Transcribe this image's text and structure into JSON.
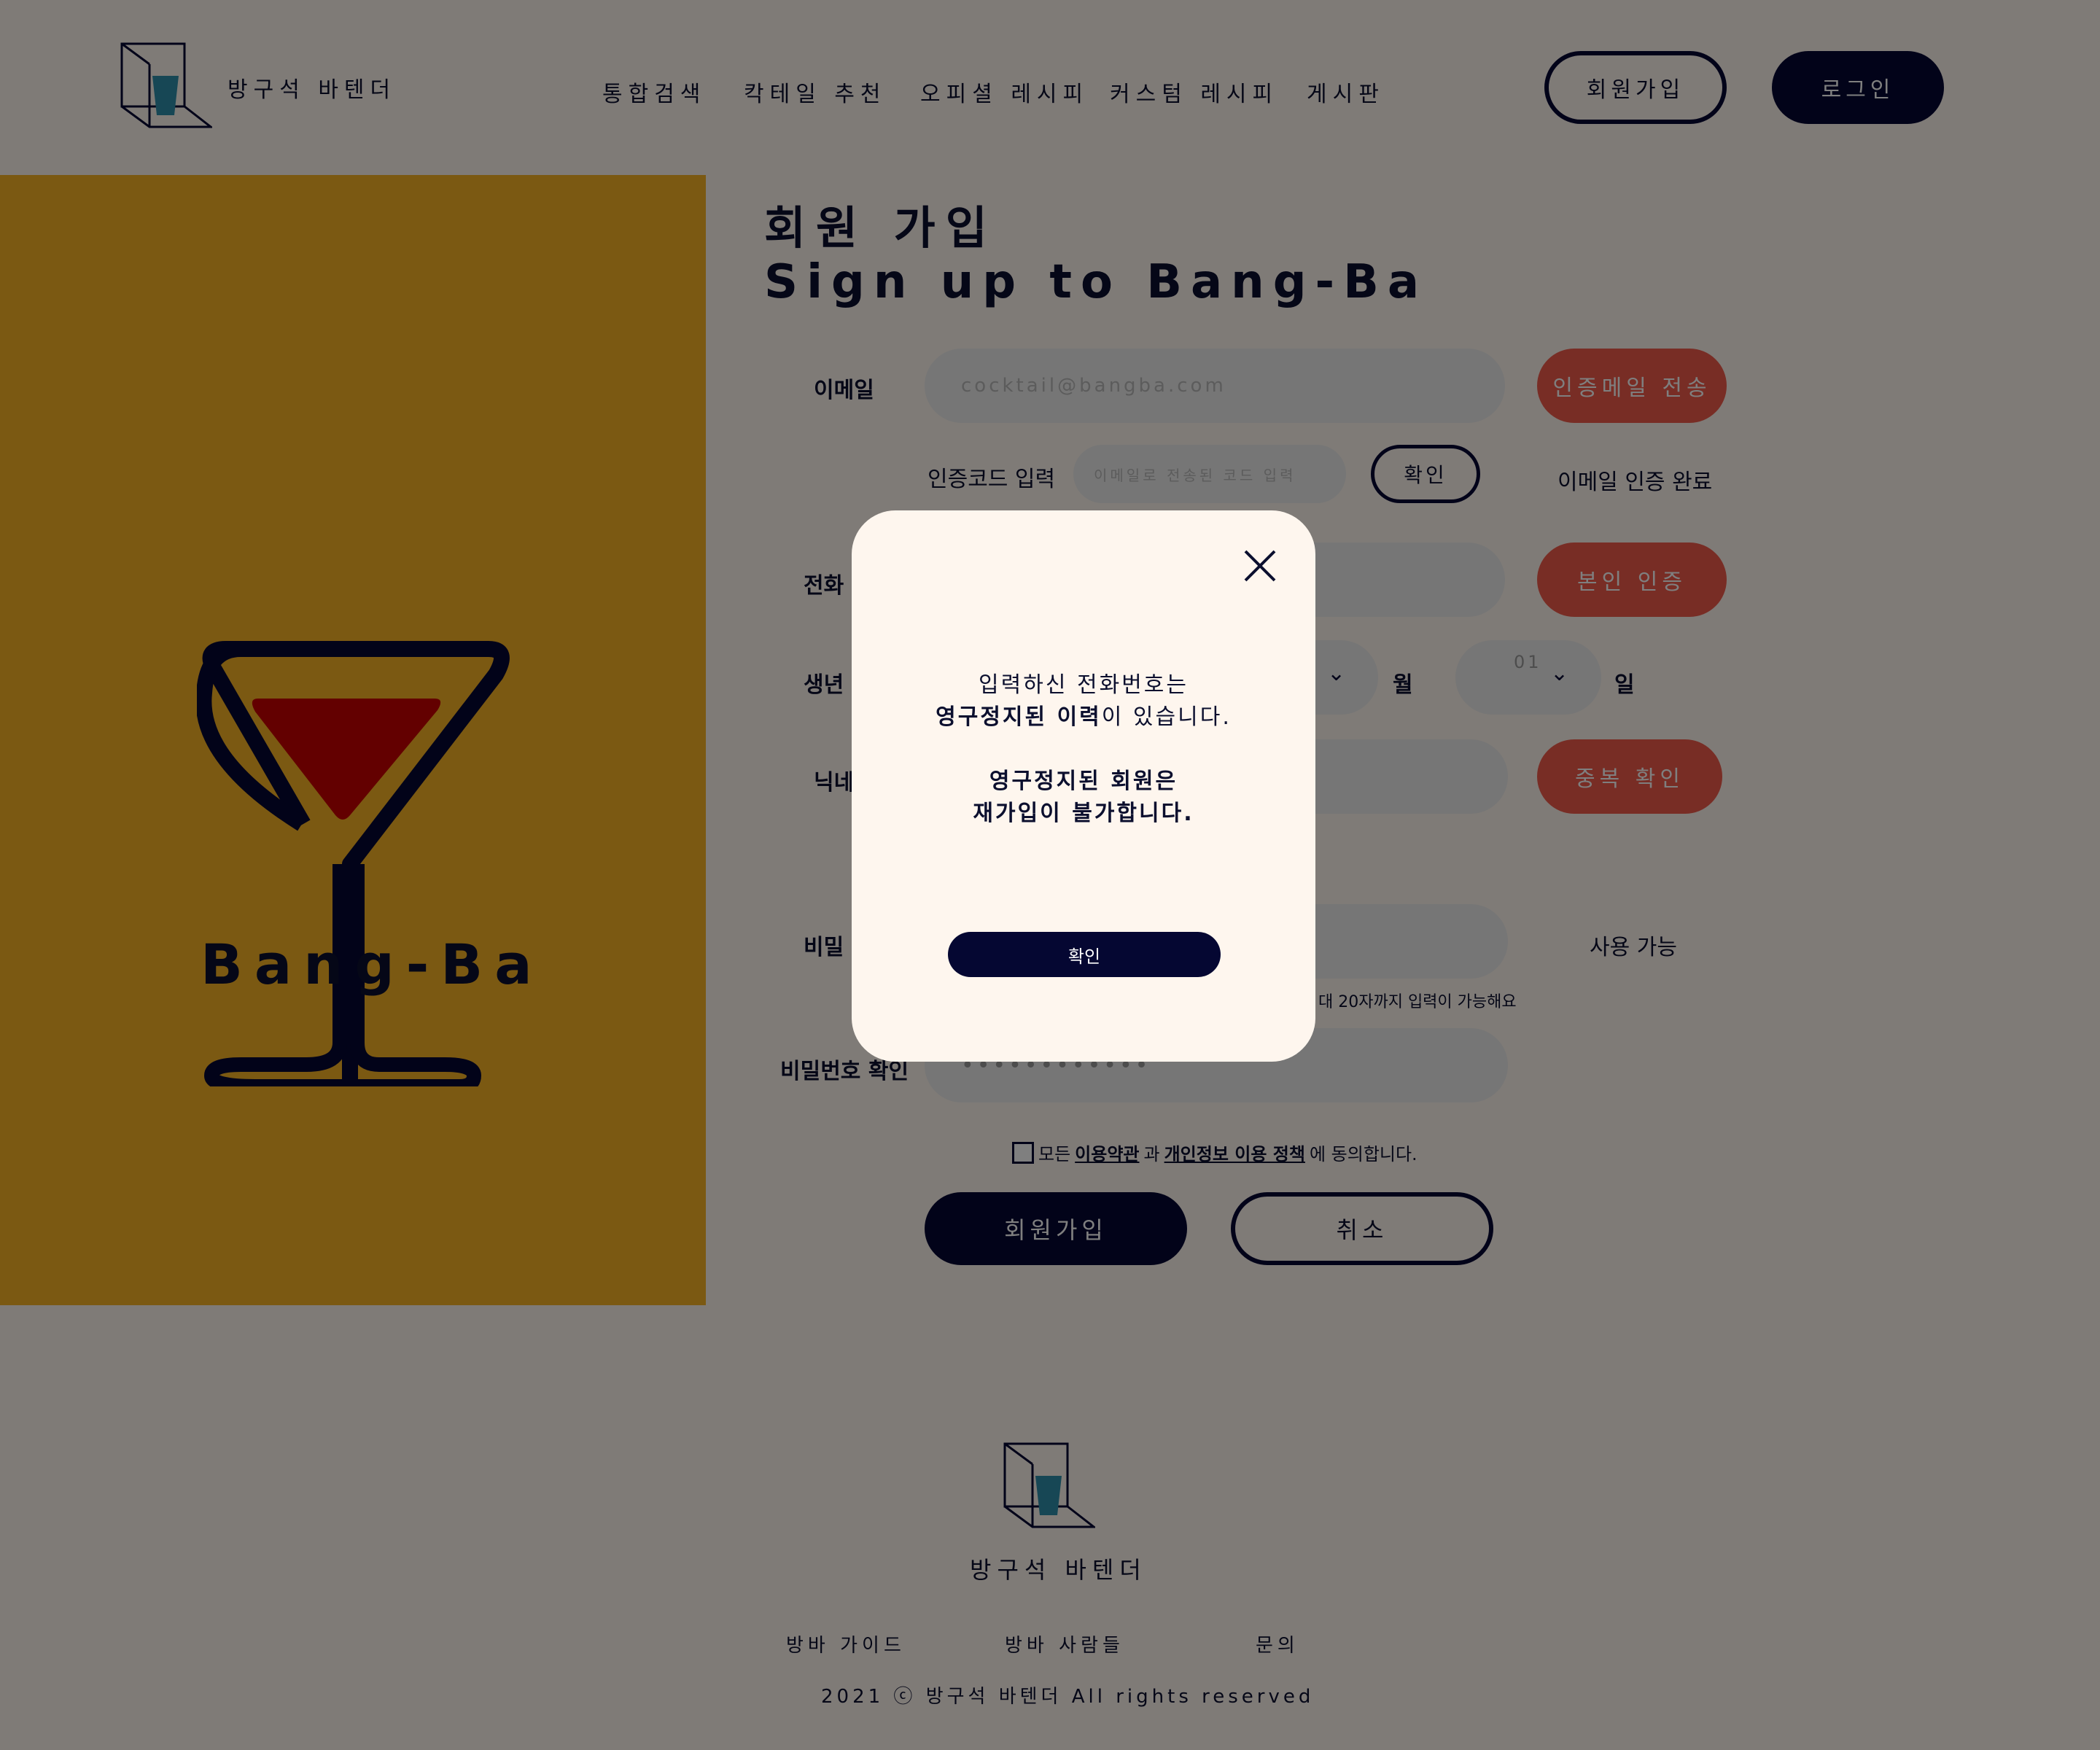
{
  "header": {
    "brand": "방구석 바텐더",
    "nav": [
      "통합검색",
      "칵테일 추천",
      "오피셜 레시피",
      "커스텀 레시피",
      "게시판"
    ],
    "signup_label": "회원가입",
    "login_label": "로그인"
  },
  "hero": {
    "brand": "Bang-Ba"
  },
  "form": {
    "title_ko": "회원 가입",
    "title_en": "Sign up to Bang-Ba",
    "email_label": "이메일",
    "email_placeholder": "cocktail@bangba.com",
    "send_mail_label": "인증메일 전송",
    "code_label": "인증코드 입력",
    "code_placeholder": "이메일로 전송된 코드 입력",
    "confirm_label": "확인",
    "email_verified": "이메일 인증 완료",
    "phone_label": "전화",
    "verify_label": "본인 인증",
    "birth_label": "생년",
    "month_unit": "월",
    "day_value": "01",
    "day_unit": "일",
    "nickname_label": "닉네",
    "dup_check_label": "중복 확인",
    "password_label": "비밀",
    "password_status": "사용 가능",
    "password_hint": "대 20자까지 입력이 가능해요",
    "password_confirm_label": "비밀번호 확인",
    "password_confirm_value": "••••••••••••",
    "terms_prefix": "모든 ",
    "terms_link1": "이용약관",
    "terms_mid": "과 ",
    "terms_link2": "개인정보 이용 정책",
    "terms_suffix": "에 동의합니다.",
    "submit_label": "회원가입",
    "cancel_label": "취소"
  },
  "footer": {
    "brand": "방구석 바텐더",
    "links": [
      "방바 가이드",
      "방바 사람들",
      "문의"
    ],
    "copyright": "2021 ⓒ 방구석 바텐더 All rights reserved"
  },
  "modal": {
    "line1": "입력하신 전화번호는",
    "line2_bold": "영구정지된 이력",
    "line2_rest": "이 있습니다.",
    "line3": "영구정지된 회원은",
    "line4": "재가입이 불가합니다.",
    "ok_label": "확인"
  },
  "colors": {
    "navy": "#050732",
    "gold": "#f6b225",
    "red": "#f05a4a",
    "teal": "#2f8eaa",
    "wine": "#c70000"
  }
}
